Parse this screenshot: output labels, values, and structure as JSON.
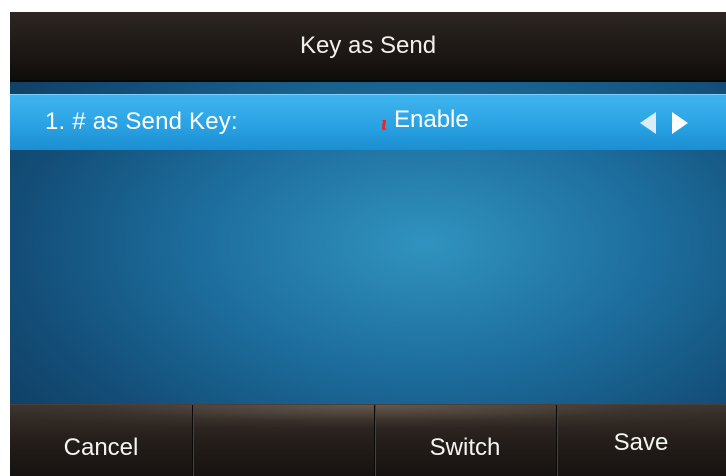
{
  "screen": {
    "title": "Key as Send"
  },
  "options": [
    {
      "label": "1. # as Send Key:",
      "value": "Enable"
    }
  ],
  "softkeys": {
    "key1": "Cancel",
    "key2": "",
    "key3": "Switch",
    "key4": "Save"
  },
  "icons": {
    "cursor": "text-cursor-icon",
    "left": "arrow-left-icon",
    "right": "arrow-right-icon"
  },
  "colors": {
    "highlight": "#2ea6e6",
    "background": "#1d6e9e",
    "bar": "#1a1512",
    "cursor": "#e8261f"
  }
}
